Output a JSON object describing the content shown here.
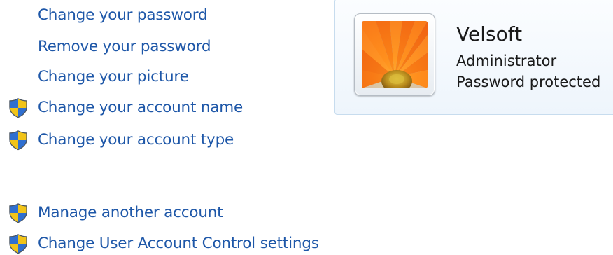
{
  "links": [
    {
      "label": "Change your password",
      "shield": false
    },
    {
      "label": "Remove your password",
      "shield": false
    },
    {
      "label": "Change your picture",
      "shield": false
    },
    {
      "label": "Change your account name",
      "shield": true
    },
    {
      "label": "Change your account type",
      "shield": true
    },
    {
      "label": "Manage another account",
      "shield": true
    },
    {
      "label": "Change User Account Control settings",
      "shield": true
    }
  ],
  "account": {
    "name": "Velsoft",
    "type": "Administrator",
    "status": "Password protected",
    "picture": "orange-gerbera-flower"
  },
  "colors": {
    "link": "#1e57a8",
    "panel_border": "#c7dcee",
    "panel_background": "#eef5fc",
    "shield_blue": "#2f6fd0",
    "shield_yellow": "#f2c418"
  },
  "icons": {
    "uac": "uac-shield-icon"
  }
}
